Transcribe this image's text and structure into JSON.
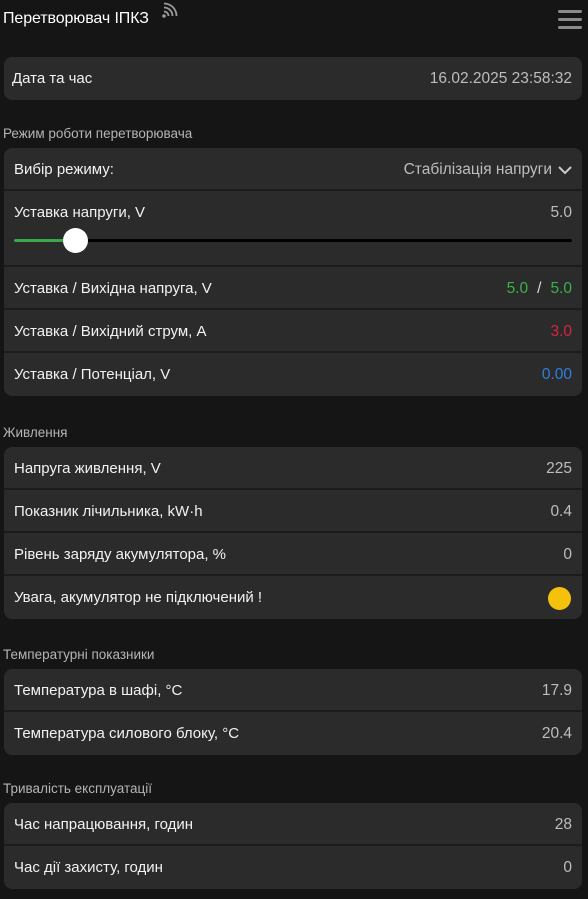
{
  "header": {
    "title": "Перетворювач ІПКЗ",
    "signal_icon": "wifi-signal-icon",
    "menu_icon": "hamburger-menu-icon"
  },
  "datetime": {
    "label": "Дата та час",
    "value": "16.02.2025 23:58:32"
  },
  "mode_section": {
    "title": "Режим роботи перетворювача",
    "mode_select": {
      "label": "Вибір режиму:",
      "value": "Стабілізація напруги"
    },
    "voltage_setpoint": {
      "label": "Уставка напруги, V",
      "value": "5.0",
      "slider_fraction": 0.11
    },
    "output_voltage": {
      "label": "Уставка / Вихідна напруга, V",
      "setpoint": "5.0",
      "separator": "/",
      "actual": "5.0"
    },
    "output_current": {
      "label": "Уставка / Вихідний струм, А",
      "value": "3.0"
    },
    "potential": {
      "label": "Уставка / Потенціал, V",
      "value": "0.00"
    }
  },
  "power_section": {
    "title": "Живлення",
    "supply_voltage": {
      "label": "Напруга живлення, V",
      "value": "225"
    },
    "meter": {
      "label": "Показник лічильника, kW·h",
      "value": "0.4"
    },
    "battery_level": {
      "label": "Рівень заряду акумулятора, %",
      "value": "0"
    },
    "battery_warning": {
      "label": "Увага, акумулятор не підключений !",
      "indicator_color": "#f4c20d"
    }
  },
  "temp_section": {
    "title": "Температурні показники",
    "cabinet": {
      "label": "Температура в шафі, °С",
      "value": "17.9"
    },
    "power_block": {
      "label": "Температура силового блоку, °С",
      "value": "20.4"
    }
  },
  "operation_section": {
    "title": "Тривалість експлуатації",
    "uptime": {
      "label": "Час напрацювання, годин",
      "value": "28"
    },
    "protection": {
      "label": "Час дії захисту, годин",
      "value": "0"
    }
  },
  "colors": {
    "background": "#151515",
    "card": "#2b2b2b",
    "green": "#3ab24a",
    "red": "#d4263e",
    "blue": "#2f7fe0",
    "warning": "#f4c20d"
  }
}
